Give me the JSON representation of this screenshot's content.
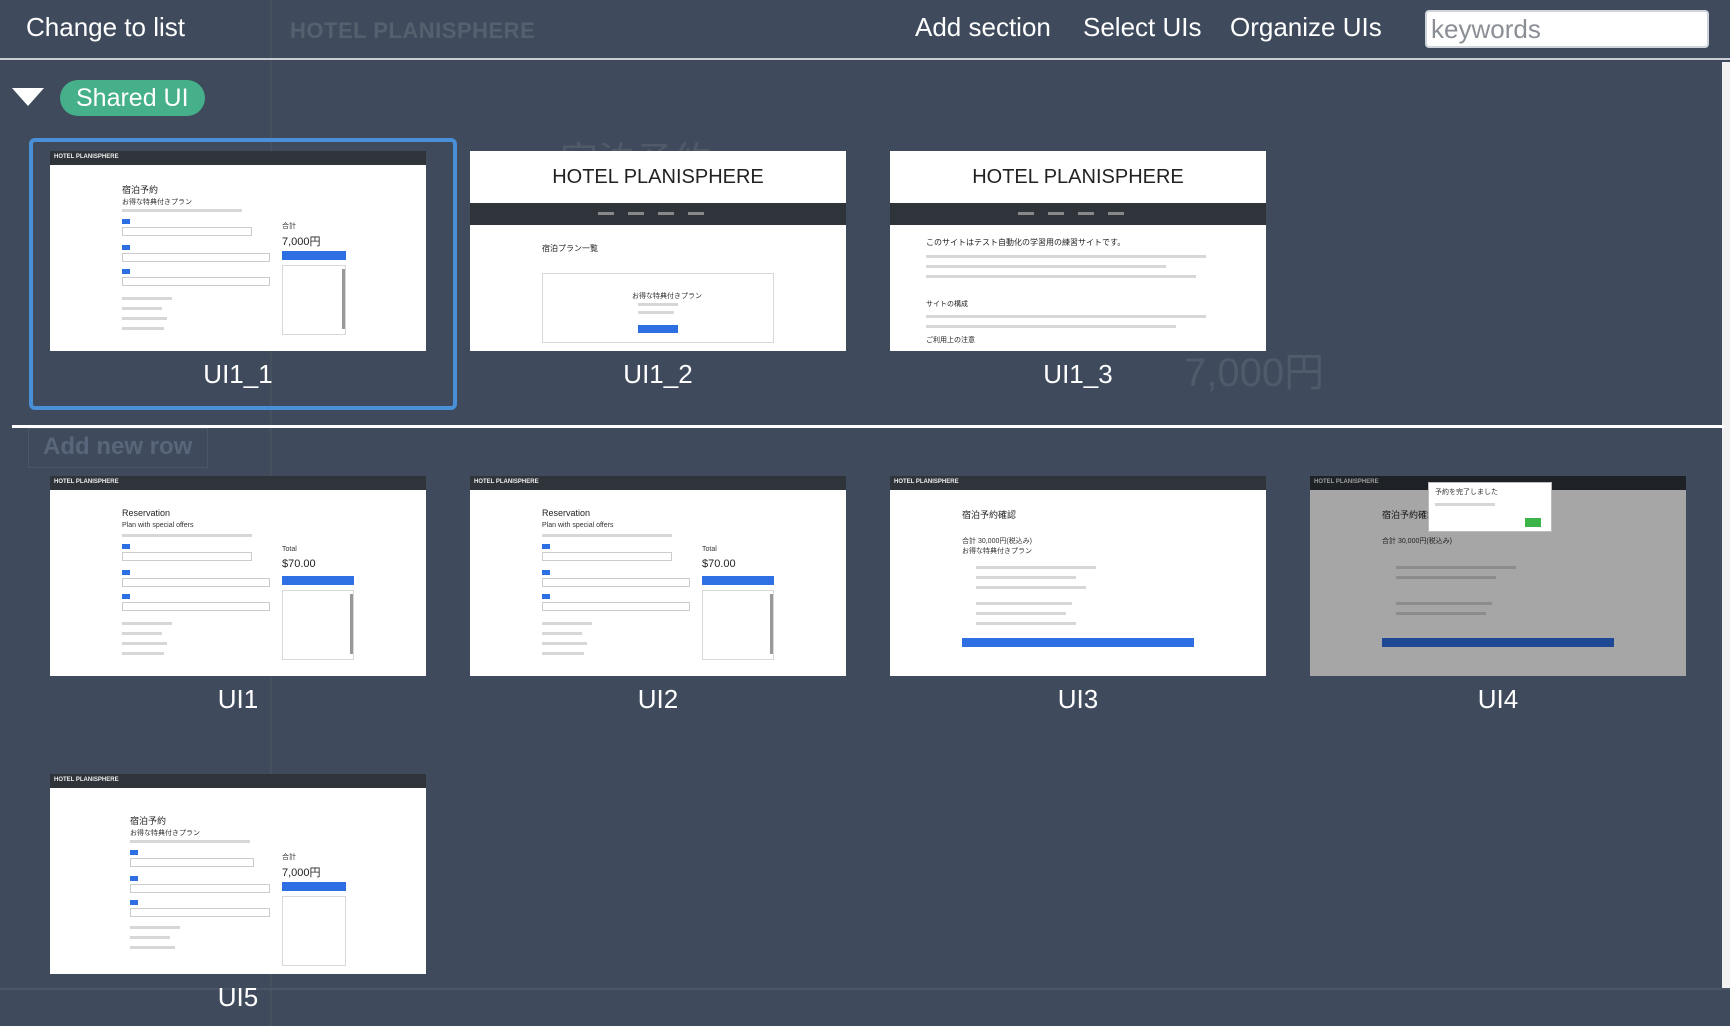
{
  "toolbar": {
    "change_view": "Change to list",
    "add_section": "Add section",
    "select_uis": "Select UIs",
    "organize_uis": "Organize UIs",
    "search_placeholder": "keywords"
  },
  "background": {
    "brand": "HOTEL PLANISPHERE",
    "add_row": "Add new row",
    "price": "7,000円",
    "heading": "宿泊予約"
  },
  "section": {
    "label": "Shared UI",
    "cards": [
      {
        "label": "UI1_1",
        "selected": true
      },
      {
        "label": "UI1_2",
        "selected": false
      },
      {
        "label": "UI1_3",
        "selected": false
      }
    ]
  },
  "rows": [
    {
      "cards": [
        {
          "label": "UI1"
        },
        {
          "label": "UI2"
        },
        {
          "label": "UI3"
        },
        {
          "label": "UI4"
        }
      ]
    },
    {
      "cards": [
        {
          "label": "UI5"
        }
      ]
    }
  ],
  "thumbs": {
    "bar_brand": "HOTEL PLANISPHERE",
    "header_brand": "HOTEL PLANISPHERE",
    "ja_title": "宿泊予約",
    "ja_sub": "お得な特典付きプラン",
    "ja_total_label": "合計",
    "ja_total": "7,000円",
    "en_title": "Reservation",
    "en_sub": "Plan with special offers",
    "en_total_label": "Total",
    "en_total": "$70.00",
    "plans_title": "宿泊プラン一覧",
    "plans_card": "お得な特典付きプラン",
    "home_title": "このサイトはテスト自動化の学習用の練習サイトです。",
    "home_sub1": "サイトの構成",
    "home_sub2": "ご利用上の注意",
    "confirm_title": "宿泊予約確認",
    "confirm_total": "合計 30,000円(税込み)",
    "confirm_plan": "お得な特典付きプラン",
    "modal_title": "予約を完了しました"
  },
  "colors": {
    "background": "#3e4a5b",
    "section_badge": "#45b08a",
    "selection": "#4a90d9"
  }
}
